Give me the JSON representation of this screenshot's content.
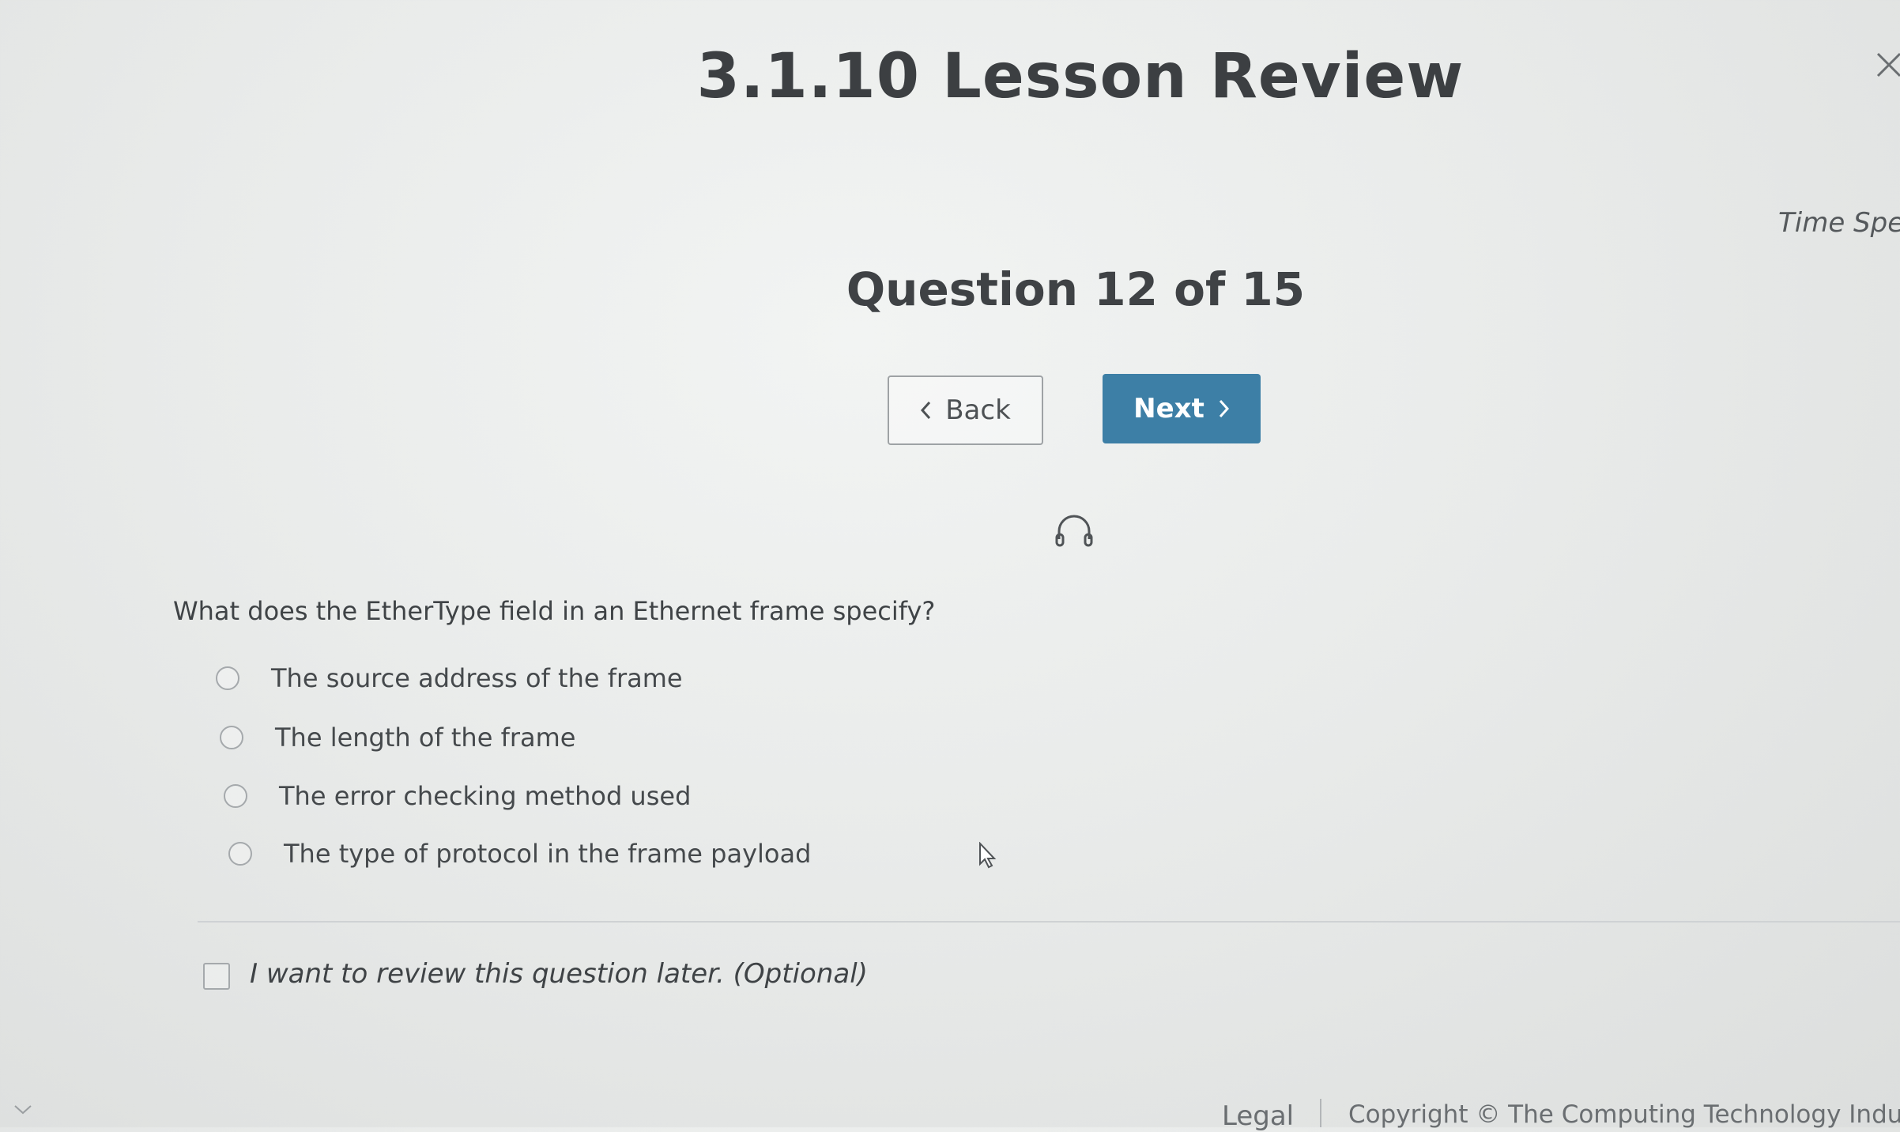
{
  "header": {
    "title": "3.1.10 Lesson Review",
    "time_spent_label": "Time Sper"
  },
  "question": {
    "counter": "Question 12 of 15",
    "prompt": "What does the EtherType field in an Ethernet frame specify?",
    "options": [
      "The source address of the frame",
      "The length of the frame",
      "The error checking method used",
      "The type of protocol in the frame payload"
    ]
  },
  "nav": {
    "back_label": "Back",
    "next_label": "Next"
  },
  "review": {
    "label": "I want to review this question later. (Optional)",
    "checked": false
  },
  "footer": {
    "legal": "Legal",
    "copyright": "Copyright © The Computing Technology Industr"
  },
  "colors": {
    "accent": "#3d7fa6",
    "text": "#3a3d40",
    "background": "#e9ebea"
  },
  "icons": [
    "close-icon",
    "chevron-left-icon",
    "chevron-right-icon",
    "headphones-icon",
    "cursor-icon",
    "chevron-down-icon"
  ]
}
